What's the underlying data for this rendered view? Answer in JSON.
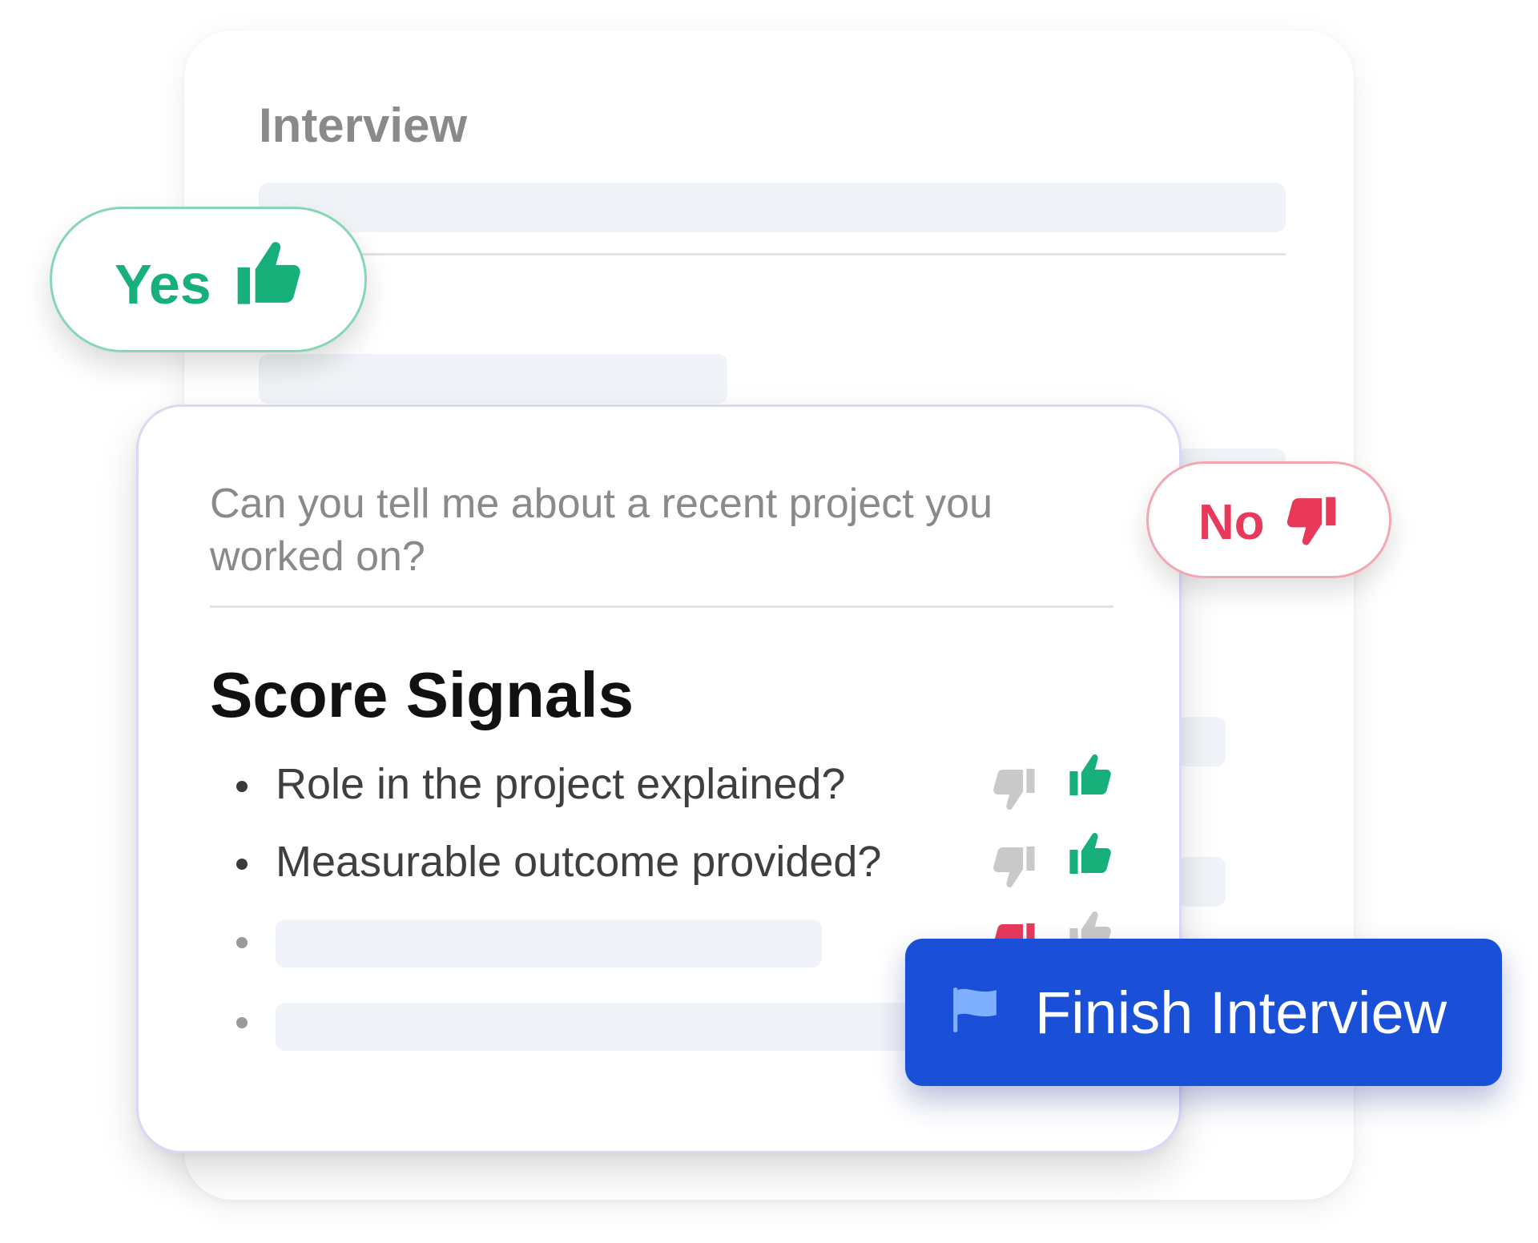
{
  "interview": {
    "title": "Interview"
  },
  "question": {
    "text": "Can you tell me about a recent project you worked on?"
  },
  "score_signals": {
    "title": "Score Signals",
    "items": [
      {
        "label": "Role in the project explained?",
        "rating": "yes"
      },
      {
        "label": "Measurable outcome provided?",
        "rating": "yes"
      },
      {
        "label": "",
        "rating": "no"
      },
      {
        "label": "",
        "rating": "none"
      }
    ]
  },
  "badges": {
    "yes_label": "Yes",
    "yes_icon": "thumbs-up-icon",
    "no_label": "No",
    "no_icon": "thumbs-down-icon"
  },
  "finish_button": {
    "label": "Finish Interview",
    "icon": "flag-icon"
  },
  "colors": {
    "positive": "#17b07a",
    "negative": "#e8395a",
    "inactive": "#c9c9c9",
    "primary": "#1a4fd8"
  }
}
